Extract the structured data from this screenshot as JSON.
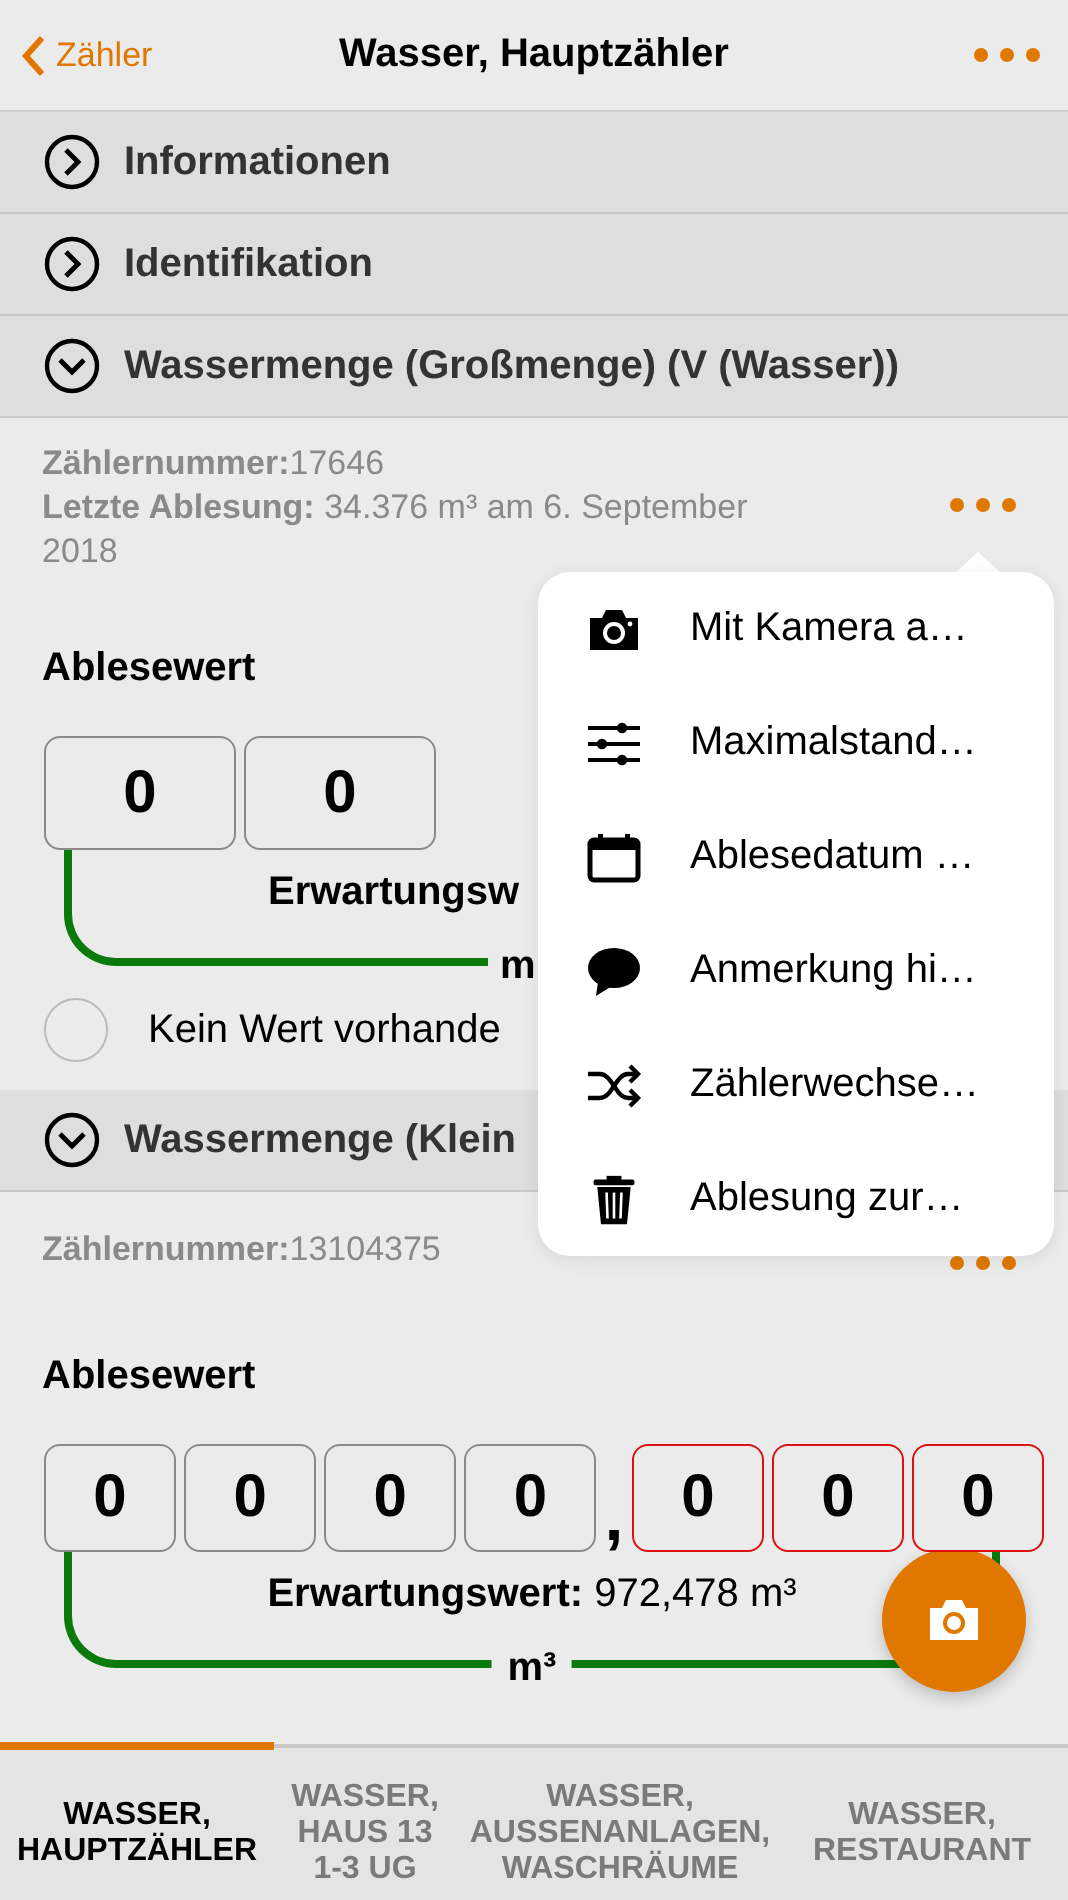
{
  "nav": {
    "back": "Zähler",
    "title": "Wasser, Hauptzähler"
  },
  "sections": [
    {
      "title": "Informationen",
      "expanded": false
    },
    {
      "title": "Identifikation",
      "expanded": false
    },
    {
      "title": "Wassermenge (Großmenge) (V (Wasser))",
      "expanded": true,
      "covered": true,
      "meter_number_label": "Zählernummer:",
      "meter_number": "17646",
      "last_reading_label": "Letzte Ablesung:",
      "last_reading": "34.376 m³ am 6. September 2018",
      "value_label": "Ablesewert",
      "digits": [
        {
          "value": "0",
          "kind": "integer"
        },
        {
          "value": "0",
          "kind": "integer"
        }
      ],
      "expected_label": "Erwartungsw",
      "unit": "m",
      "no_value": {
        "label": "Kein Wert vorhande",
        "checked": false
      }
    },
    {
      "title": "Wassermenge (Klein",
      "expanded": true,
      "covered": false,
      "meter_number_label": "Zählernummer:",
      "meter_number": "13104375",
      "value_label": "Ablesewert",
      "digits": [
        {
          "value": "0",
          "kind": "integer"
        },
        {
          "value": "0",
          "kind": "integer"
        },
        {
          "value": "0",
          "kind": "integer"
        },
        {
          "value": "0",
          "kind": "integer"
        },
        {
          "value": ",",
          "kind": "separator"
        },
        {
          "value": "0",
          "kind": "decimal"
        },
        {
          "value": "0",
          "kind": "decimal"
        },
        {
          "value": "0",
          "kind": "decimal"
        }
      ],
      "expected_label": "Erwartungswert:",
      "expected_value": "972,478 m³",
      "unit": "m³"
    }
  ],
  "menu": [
    {
      "kind": "camera",
      "label": "Mit Kamera a…"
    },
    {
      "kind": "sliders",
      "label": "Maximalstand…"
    },
    {
      "kind": "calendar",
      "label": "Ablesedatum …"
    },
    {
      "kind": "comment",
      "label": "Anmerkung hi…"
    },
    {
      "kind": "shuffle",
      "label": "Zählerwechse…"
    },
    {
      "kind": "trash",
      "label": "Ablesung zur…"
    }
  ],
  "tabs": [
    {
      "label": "WASSER, HAUPTZÄHLER",
      "selected": true
    },
    {
      "label": "WASSER, HAUS 13 1-3 UG",
      "selected": false
    },
    {
      "label": "WASSER, AUSSENANLAGEN, WASCHRÄUME",
      "selected": false
    },
    {
      "label": "WASSER, RESTAURANT",
      "selected": false
    }
  ]
}
